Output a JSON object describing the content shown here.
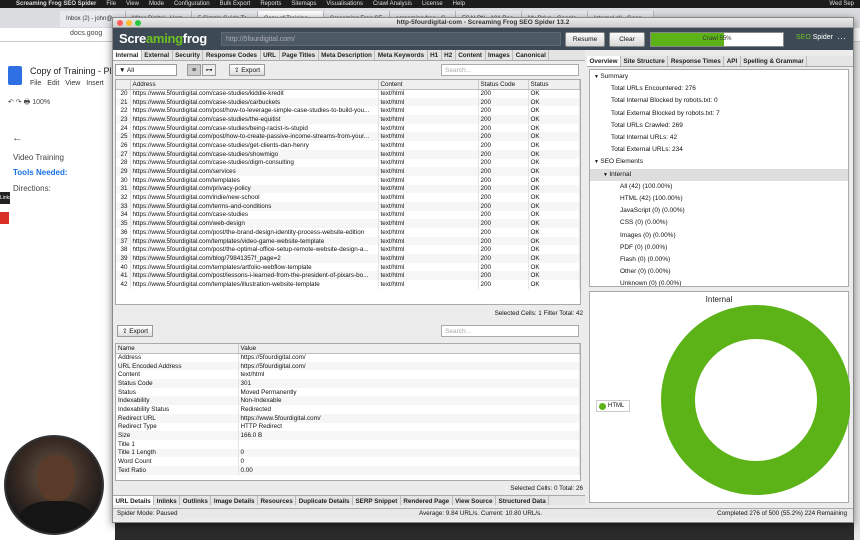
{
  "mac_menu": [
    "Screaming Frog SEO Spider",
    "File",
    "View",
    "Mode",
    "Configuration",
    "Bulk Export",
    "Reports",
    "Sitemaps",
    "Visualisations",
    "Crawl Analysis",
    "License",
    "Help"
  ],
  "mac_right": "Wed Sep",
  "chrome_tabs": [
    "Inbox (2) - john@",
    "Mitos Digital - Hom",
    "5 Simple Guide To",
    "Copy of Training",
    "Screaming Frog SE",
    "screaming frog - G",
    "FSAI PN - 101 Rec",
    "My Drive - Google",
    "Internal all - Goog"
  ],
  "chrome_url": "docs.goog",
  "gdoc": {
    "title": "Copy of Training - Pl",
    "menu": [
      "File",
      "Edit",
      "View",
      "Insert"
    ],
    "zoom": "100%",
    "lines": [
      "Video Training",
      "Tools Needed:",
      "Directions:"
    ],
    "side_label": "Links"
  },
  "sf": {
    "window_title": "http-5fourdigital-com - Screaming Frog SEO Spider 13.2",
    "logo_a": "Scre",
    "logo_b": "aming",
    "logo_c": "frog",
    "url": "http://5fourdigital.com/",
    "resume": "Resume",
    "clear": "Clear",
    "crawl_label": "Crawl 55%",
    "crawl_progress": 0.552,
    "seo_a": "SEO",
    "seo_b": "Spider",
    "tabs": [
      "Internal",
      "External",
      "Security",
      "Response Codes",
      "URL",
      "Page Titles",
      "Meta Description",
      "Meta Keywords",
      "H1",
      "H2",
      "Content",
      "Images",
      "Canonical"
    ],
    "filter": "All",
    "export": "Export",
    "search_placeholder": "Search...",
    "columns": [
      "",
      "Address",
      "Content",
      "Status Code",
      "Status"
    ],
    "rows": [
      [
        "20",
        "https://www.5fourdigital.com/case-studies/kiddie-kredit",
        "text/html",
        "200",
        "OK"
      ],
      [
        "21",
        "https://www.5fourdigital.com/case-studies/carbuckets",
        "text/html",
        "200",
        "OK"
      ],
      [
        "22",
        "https://www.5fourdigital.com/post/how-to-leverage-simple-case-studies-to-build-you...",
        "text/html",
        "200",
        "OK"
      ],
      [
        "23",
        "https://www.5fourdigital.com/case-studies/the-equitist",
        "text/html",
        "200",
        "OK"
      ],
      [
        "24",
        "https://www.5fourdigital.com/case-studies/being-racist-is-stupid",
        "text/html",
        "200",
        "OK"
      ],
      [
        "25",
        "https://www.5fourdigital.com/post/how-to-create-passive-income-streams-from-your...",
        "text/html",
        "200",
        "OK"
      ],
      [
        "26",
        "https://www.5fourdigital.com/case-studies/get-clients-dan-henry",
        "text/html",
        "200",
        "OK"
      ],
      [
        "27",
        "https://www.5fourdigital.com/case-studies/showmigo",
        "text/html",
        "200",
        "OK"
      ],
      [
        "28",
        "https://www.5fourdigital.com/case-studies/digm-consulting",
        "text/html",
        "200",
        "OK"
      ],
      [
        "29",
        "https://www.5fourdigital.com/services",
        "text/html",
        "200",
        "OK"
      ],
      [
        "30",
        "https://www.5fourdigital.com/templates",
        "text/html",
        "200",
        "OK"
      ],
      [
        "31",
        "https://www.5fourdigital.com/privacy-policy",
        "text/html",
        "200",
        "OK"
      ],
      [
        "32",
        "https://www.5fourdigital.com/indie/new-school",
        "text/html",
        "200",
        "OK"
      ],
      [
        "33",
        "https://www.5fourdigital.com/terms-and-conditions",
        "text/html",
        "200",
        "OK"
      ],
      [
        "34",
        "https://www.5fourdigital.com/case-studies",
        "text/html",
        "200",
        "OK"
      ],
      [
        "35",
        "https://www.5fourdigital.com/web-design",
        "text/html",
        "200",
        "OK"
      ],
      [
        "36",
        "https://www.5fourdigital.com/post/the-brand-design-identity-process-website-edition",
        "text/html",
        "200",
        "OK"
      ],
      [
        "37",
        "https://www.5fourdigital.com/templates/video-game-website-template",
        "text/html",
        "200",
        "OK"
      ],
      [
        "38",
        "https://www.5fourdigital.com/post/the-optimal-office-setup-remote-website-design-a...",
        "text/html",
        "200",
        "OK"
      ],
      [
        "39",
        "https://www.5fourdigital.com/blog/79841357f_page=2",
        "text/html",
        "200",
        "OK"
      ],
      [
        "40",
        "https://www.5fourdigital.com/templates/artfolio-webflow-template",
        "text/html",
        "200",
        "OK"
      ],
      [
        "41",
        "https://www.5fourdigital.com/post/lessons-i-learned-from-the-president-of-pixars-bo...",
        "text/html",
        "200",
        "OK"
      ],
      [
        "42",
        "https://www.5fourdigital.com/templates/illustration-website-template",
        "text/html",
        "200",
        "OK"
      ]
    ],
    "status_top": "Selected Cells: 1  Filter Total: 42",
    "detail_columns": [
      "Name",
      "Value"
    ],
    "details": [
      [
        "Address",
        "https://5fourdigital.com/"
      ],
      [
        "URL Encoded Address",
        "https://5fourdigital.com/"
      ],
      [
        "Content",
        "text/html"
      ],
      [
        "Status Code",
        "301"
      ],
      [
        "Status",
        "Moved Permanently"
      ],
      [
        "Indexability",
        "Non-Indexable"
      ],
      [
        "Indexability Status",
        "Redirected"
      ],
      [
        "Redirect URL",
        "https://www.5fourdigital.com/"
      ],
      [
        "Redirect Type",
        "HTTP Redirect"
      ],
      [
        "Size",
        "166.0 B"
      ],
      [
        "Title 1",
        ""
      ],
      [
        "Title 1 Length",
        "0"
      ],
      [
        "Word Count",
        "0"
      ],
      [
        "Text Ratio",
        "0.00"
      ]
    ],
    "status_bottom": "Selected Cells: 0  Total: 26",
    "lower_tabs": [
      "URL Details",
      "Inlinks",
      "Outlinks",
      "Image Details",
      "Resources",
      "Duplicate Details",
      "SERP Snippet",
      "Rendered Page",
      "View Source",
      "Structured Data"
    ],
    "bottom_left": "Spider Mode: Paused",
    "bottom_mid": "Average: 9.84 URL/s. Current: 10.80 URL/s.",
    "bottom_right": "Completed 276 of 500 (55.2%) 224 Remaining",
    "right_tabs": [
      "Overview",
      "Site Structure",
      "Response Times",
      "API",
      "Spelling & Grammar"
    ],
    "overview": [
      {
        "indent": 0,
        "arrow": "▼",
        "text": "Summary"
      },
      {
        "indent": 1,
        "arrow": "",
        "text": "Total URLs Encountered: 276"
      },
      {
        "indent": 1,
        "arrow": "",
        "text": "Total Internal Blocked by robots.txt: 0"
      },
      {
        "indent": 1,
        "arrow": "",
        "text": "Total External Blocked by robots.txt: 7"
      },
      {
        "indent": 1,
        "arrow": "",
        "text": "Total URLs Crawled: 269"
      },
      {
        "indent": 1,
        "arrow": "",
        "text": "Total Internal URLs: 42"
      },
      {
        "indent": 1,
        "arrow": "",
        "text": "Total External URLs: 234"
      },
      {
        "indent": 0,
        "arrow": "▼",
        "text": "SEO Elements"
      },
      {
        "indent": 1,
        "arrow": "▼",
        "text": "Internal",
        "hl": true
      },
      {
        "indent": 2,
        "arrow": "",
        "text": "All (42) (100.00%)"
      },
      {
        "indent": 2,
        "arrow": "",
        "text": "HTML (42) (100.00%)"
      },
      {
        "indent": 2,
        "arrow": "",
        "text": "JavaScript (0) (0.00%)"
      },
      {
        "indent": 2,
        "arrow": "",
        "text": "CSS (0) (0.00%)"
      },
      {
        "indent": 2,
        "arrow": "",
        "text": "Images (0) (0.00%)"
      },
      {
        "indent": 2,
        "arrow": "",
        "text": "PDF (0) (0.00%)"
      },
      {
        "indent": 2,
        "arrow": "",
        "text": "Flash (0) (0.00%)"
      },
      {
        "indent": 2,
        "arrow": "",
        "text": "Other (0) (0.00%)"
      },
      {
        "indent": 2,
        "arrow": "",
        "text": "Unknown (0) (0.00%)"
      }
    ],
    "chart_title": "Internal",
    "legend": "HTML",
    "donut_color": "#5bb317"
  }
}
